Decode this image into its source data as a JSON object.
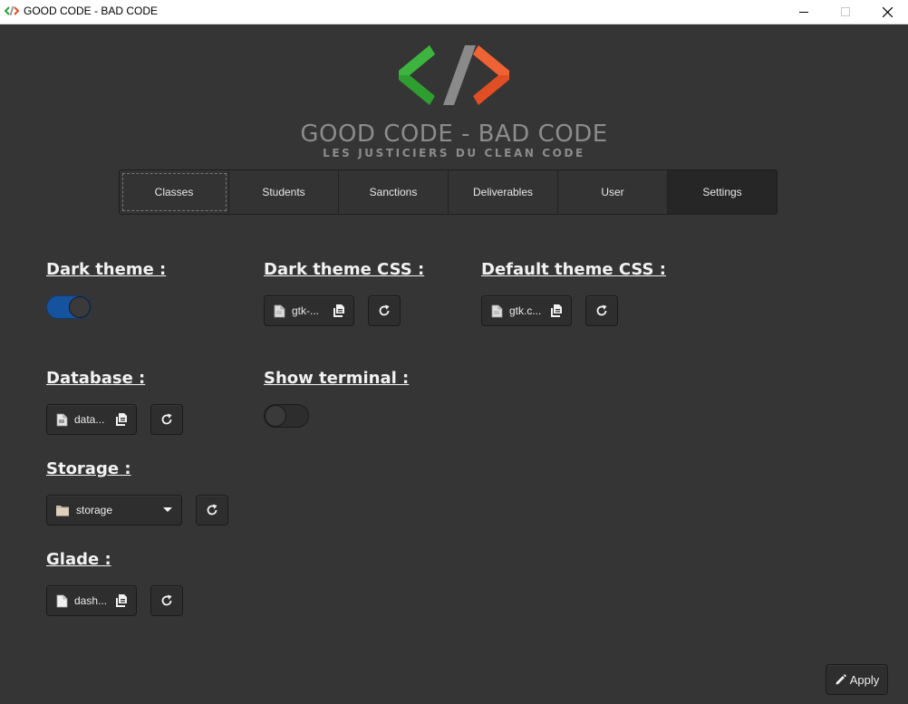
{
  "window": {
    "title": "GOOD CODE - BAD CODE",
    "controls": {
      "minimize": "minimize",
      "maximize": "maximize",
      "close": "close"
    }
  },
  "logo": {
    "title": "GOOD CODE - BAD CODE",
    "subtitle": "LES JUSTICIERS DU CLEAN CODE",
    "colors": {
      "left_bracket": "#2e9e31",
      "slash": "#8a8a8a",
      "right_bracket": "#e04e24"
    }
  },
  "tabs": [
    {
      "label": "Classes",
      "state": "focused"
    },
    {
      "label": "Students",
      "state": "normal"
    },
    {
      "label": "Sanctions",
      "state": "normal"
    },
    {
      "label": "Deliverables",
      "state": "normal"
    },
    {
      "label": "User",
      "state": "normal"
    },
    {
      "label": "Settings",
      "state": "active"
    }
  ],
  "settings": {
    "dark_theme": {
      "label": "Dark theme :",
      "enabled": true
    },
    "dark_theme_css": {
      "label": "Dark theme CSS :",
      "file": "gtk-..."
    },
    "default_theme_css": {
      "label": "Default theme CSS :",
      "file": "gtk.c..."
    },
    "database": {
      "label": "Database :",
      "file": "data..."
    },
    "show_terminal": {
      "label": "Show terminal :",
      "enabled": false
    },
    "storage": {
      "label": "Storage :",
      "folder": "storage"
    },
    "glade": {
      "label": "Glade :",
      "file": "dash..."
    }
  },
  "actions": {
    "apply_label": "Apply"
  },
  "icons": {
    "file": "document-icon",
    "open": "open-file-icon",
    "reset": "refresh-icon",
    "folder": "folder-icon",
    "dropdown": "caret-down-icon",
    "apply": "pencil-icon"
  },
  "colors": {
    "background": "#353535",
    "accent": "#15539e"
  }
}
